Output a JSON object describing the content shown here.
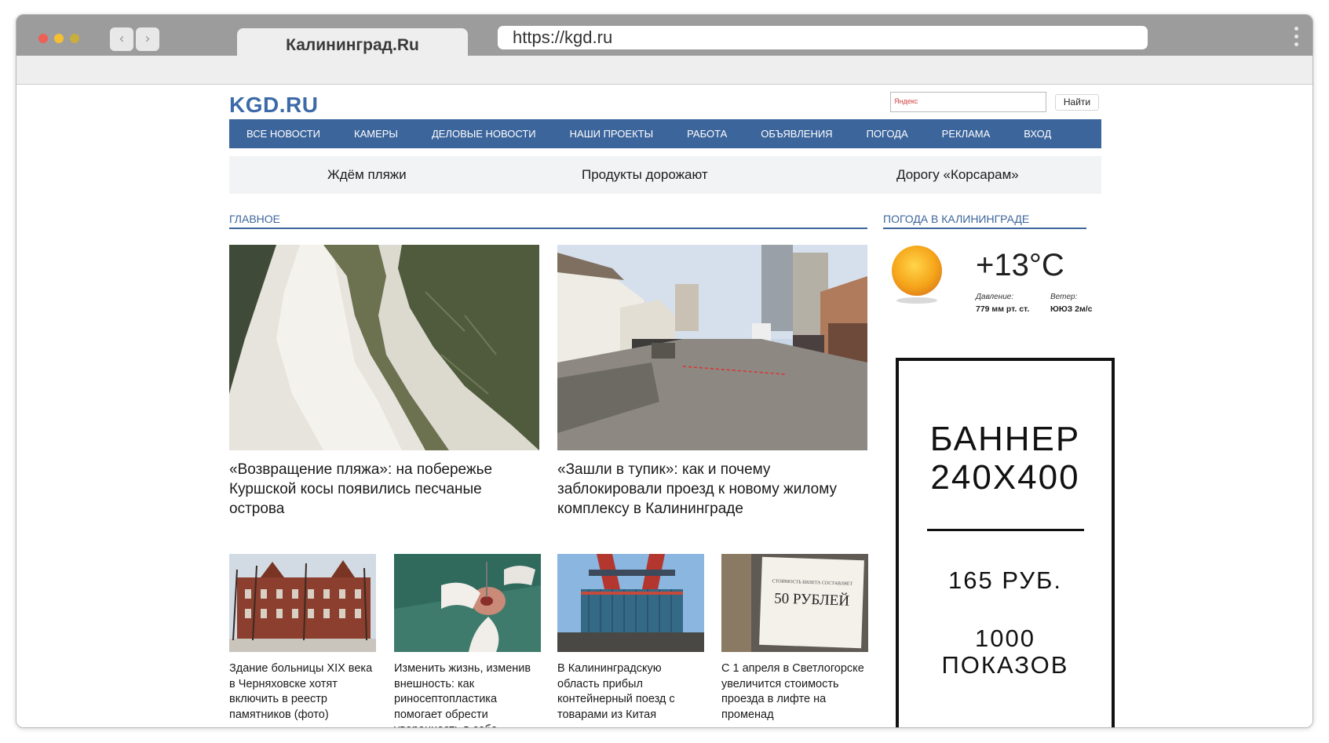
{
  "browser": {
    "tab_title": "Калининград.Ru",
    "url": "https://kgd.ru",
    "back_glyph": "‹",
    "forward_glyph": "›",
    "lights": [
      "#ee5f56",
      "#f5bf2f",
      "#c8ad3f"
    ]
  },
  "site": {
    "logo": "KGD.RU",
    "search_placeholder": "Яндекс",
    "search_button": "Найти",
    "accent_color": "#3c659c"
  },
  "nav": {
    "items": [
      "ВСЕ НОВОСТИ",
      "КАМЕРЫ",
      "ДЕЛОВЫЕ НОВОСТИ",
      "НАШИ ПРОЕКТЫ",
      "РАБОТА",
      "ОБЪЯВЛЕНИЯ",
      "ПОГОДА",
      "РЕКЛАМА",
      "ВХОД"
    ]
  },
  "hot_topics": [
    "Ждём пляжи",
    "Продукты дорожают",
    "Дорогу «Корсарам»"
  ],
  "main": {
    "section_title": "ГЛАВНОЕ",
    "big_stories": [
      {
        "title": "«Возвращение пляжа»: на побережье Куршской косы появились песчаные острова",
        "image": "aerial-beach-photo"
      },
      {
        "title": "«Зашли в тупик»: как и почему заблокировали проезд к новому жилому комплексу в Калининграде",
        "image": "blocked-street-photo"
      }
    ],
    "small_stories": [
      {
        "title": "Здание больницы XIX века в Черняховске хотят включить в реестр памятников (фото)",
        "image": "hospital-building-photo"
      },
      {
        "title": "Изменить жизнь, изменив внешность: как риносептопластика помогает обрести уверенность в себе",
        "image": "surgery-photo"
      },
      {
        "title": "В Калининградскую область прибыл контейнерный поезд с товарами из Китая",
        "image": "container-crane-photo"
      },
      {
        "title": "С 1 апреля в Светлогорске увеличится стоимость проезда в лифте на променад",
        "image": "ticket-price-sign-photo"
      }
    ],
    "sign_heading": "СТОИМОСТЬ БИЛЕТА СОСТАВЛЯЕТ",
    "sign_price": "50 РУБЛЕЙ"
  },
  "weather": {
    "section_title": "ПОГОДА В КАЛИНИНГРАДЕ",
    "temperature": "+13°C",
    "pressure_label": "Давление:",
    "pressure_value": "779 мм рт. ст.",
    "wind_label": "Ветер:",
    "wind_value": "ЮЮЗ 2м/с",
    "icon": "sun-icon"
  },
  "banner": {
    "line1": "БАННЕР",
    "line2": "240X400",
    "price": "165 РУБ.",
    "impressions_1": "1000",
    "impressions_2": "ПОКАЗОВ"
  }
}
